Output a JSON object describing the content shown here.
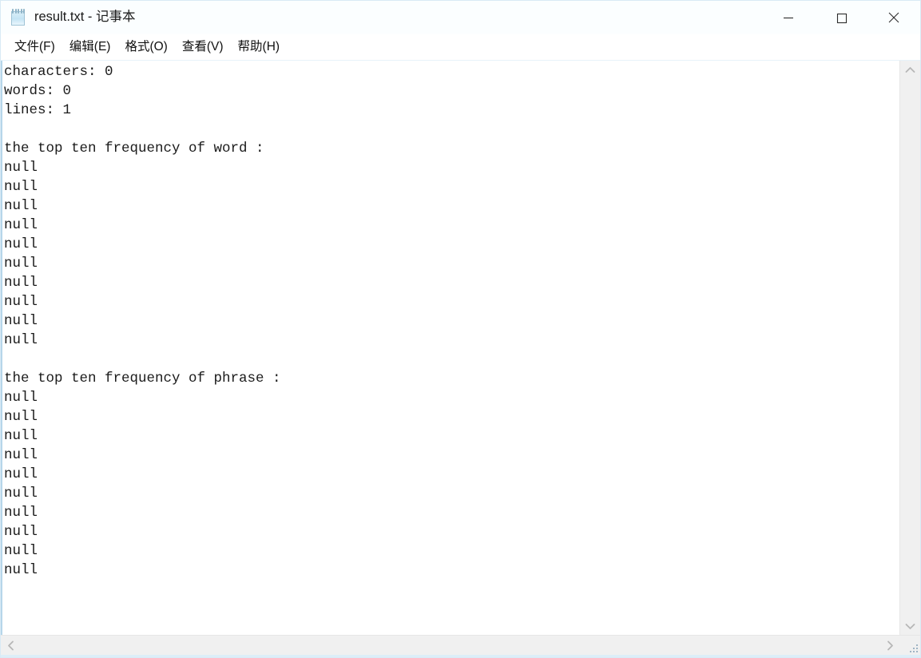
{
  "window": {
    "title": "result.txt - 记事本",
    "file_name": "result.txt",
    "app_name": "记事本",
    "icon": "notepad-icon",
    "frame_color": "#d9eaf5",
    "titlebar_color": "#fbfeff"
  },
  "window_controls": [
    {
      "name": "minimize-button",
      "glyph": "minimize-icon",
      "label": "—"
    },
    {
      "name": "maximize-button",
      "glyph": "maximize-icon",
      "label": "□"
    },
    {
      "name": "close-button",
      "glyph": "close-icon",
      "label": "✕"
    }
  ],
  "menubar": {
    "items": [
      {
        "label": "文件(F)",
        "name": "menu-file"
      },
      {
        "label": "编辑(E)",
        "name": "menu-edit"
      },
      {
        "label": "格式(O)",
        "name": "menu-format"
      },
      {
        "label": "查看(V)",
        "name": "menu-view"
      },
      {
        "label": "帮助(H)",
        "name": "menu-help"
      }
    ]
  },
  "document": {
    "background": "#ffffff",
    "text_color": "#1b1b1b",
    "stats": {
      "characters_label": "characters:",
      "characters_value": "0",
      "words_label": "words:",
      "words_value": "0",
      "lines_label": "lines:",
      "lines_value": "1"
    },
    "section_word_heading": "the top ten frequency of word :",
    "section_phrase_heading": "the top ten frequency of phrase :",
    "word_entries": [
      "null",
      "null",
      "null",
      "null",
      "null",
      "null",
      "null",
      "null",
      "null",
      "null"
    ],
    "phrase_entries": [
      "null",
      "null",
      "null",
      "null",
      "null",
      "null",
      "null",
      "null",
      "null",
      "null"
    ],
    "content": "characters: 0\nwords: 0\nlines: 1\n\nthe top ten frequency of word :\nnull\nnull\nnull\nnull\nnull\nnull\nnull\nnull\nnull\nnull\n\nthe top ten frequency of phrase :\nnull\nnull\nnull\nnull\nnull\nnull\nnull\nnull\nnull\nnull"
  },
  "scrollbars": {
    "vertical": {
      "up_arrow": "chevron-up-icon",
      "down_arrow": "chevron-down-icon",
      "track_color": "#f0f0f0"
    },
    "horizontal": {
      "left_arrow": "chevron-left-icon",
      "right_arrow": "chevron-right-icon",
      "track_color": "#f0f0f0"
    },
    "resize_grip": "resize-grip-icon"
  }
}
